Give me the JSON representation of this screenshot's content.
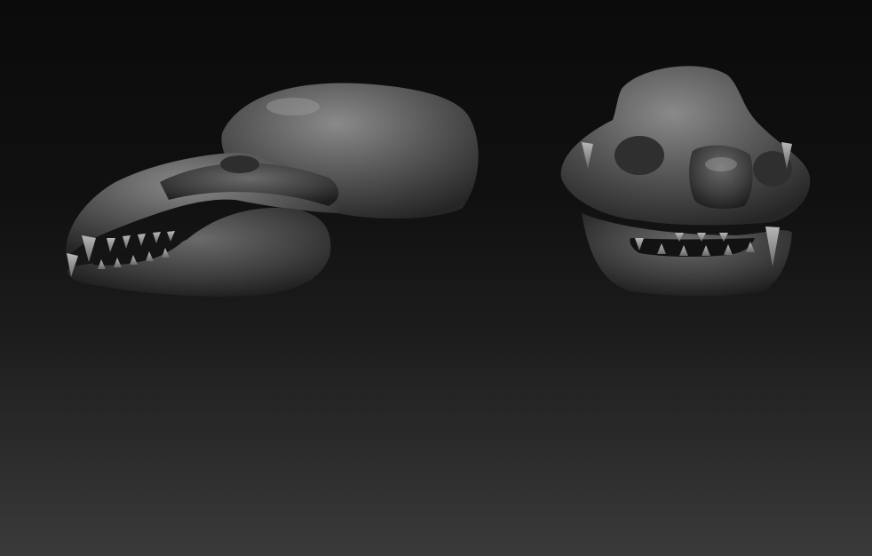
{
  "scene": {
    "background_top": "#0b0b0b",
    "background_bottom": "#3a3a3a",
    "material_color": "#5e5e5e",
    "objects": [
      {
        "name": "skull-side-view"
      },
      {
        "name": "skull-front-view"
      }
    ]
  }
}
